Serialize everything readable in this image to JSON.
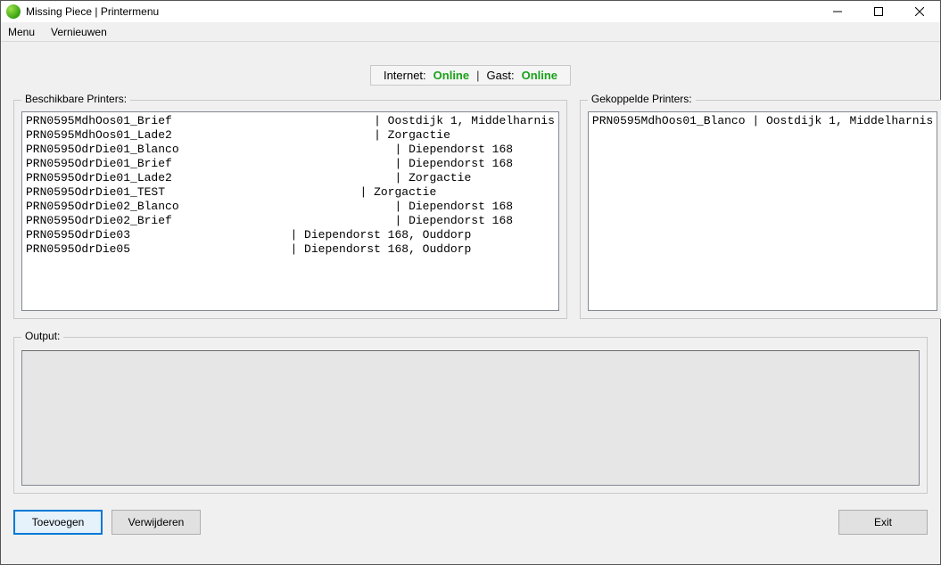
{
  "window": {
    "title": "Missing Piece | Printermenu"
  },
  "menubar": {
    "menu": "Menu",
    "refresh": "Vernieuwen"
  },
  "status": {
    "internet_label": "Internet:",
    "internet_status": "Online",
    "guest_label": "Gast:",
    "guest_status": "Online",
    "separator": "|"
  },
  "groups": {
    "available_legend": "Beschikbare Printers:",
    "linked_legend": "Gekoppelde Printers:",
    "output_legend": "Output:"
  },
  "available_printers_text": "PRN0595MdhOos01_Brief                             | Oostdijk 1, Middelharnis\nPRN0595MdhOos01_Lade2                             | Zorgactie\nPRN0595OdrDie01_Blanco                               | Diependorst 168\nPRN0595OdrDie01_Brief                                | Diependorst 168\nPRN0595OdrDie01_Lade2                                | Zorgactie\nPRN0595OdrDie01_TEST                            | Zorgactie\nPRN0595OdrDie02_Blanco                               | Diependorst 168\nPRN0595OdrDie02_Brief                                | Diependorst 168\nPRN0595OdrDie03                       | Diependorst 168, Ouddorp\nPRN0595OdrDie05                       | Diependorst 168, Ouddorp",
  "linked_printers_text": "PRN0595MdhOos01_Blanco | Oostdijk 1, Middelharnis",
  "buttons": {
    "add": "Toevoegen",
    "remove": "Verwijderen",
    "exit": "Exit"
  }
}
